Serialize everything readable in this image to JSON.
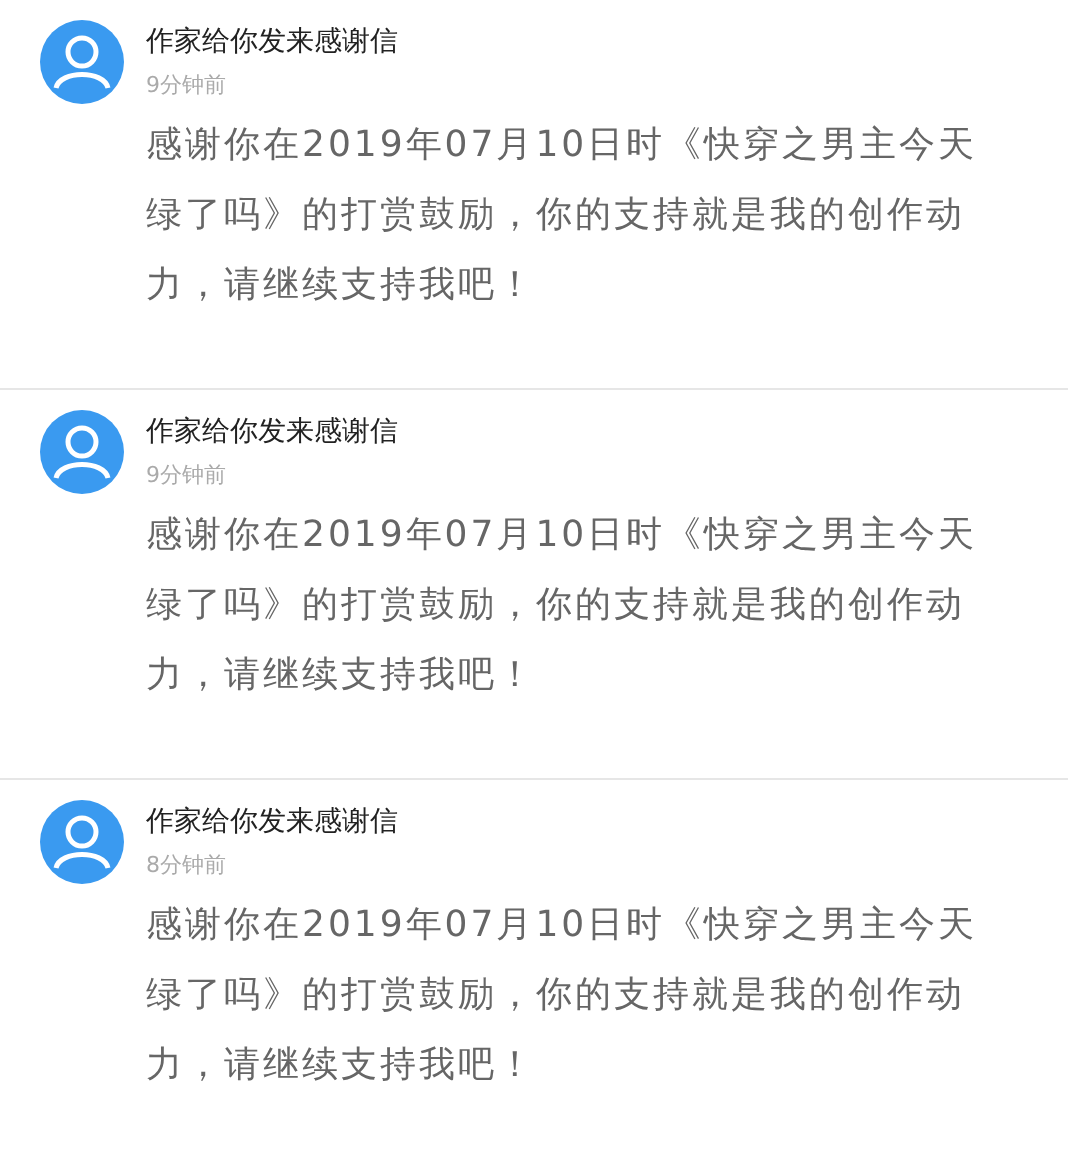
{
  "messages": [
    {
      "title": "作家给你发来感谢信",
      "time": "9分钟前",
      "body": "感谢你在2019年07月10日时《快穿之男主今天绿了吗》的打赏鼓励，你的支持就是我的创作动力，请继续支持我吧！"
    },
    {
      "title": "作家给你发来感谢信",
      "time": "9分钟前",
      "body": "感谢你在2019年07月10日时《快穿之男主今天绿了吗》的打赏鼓励，你的支持就是我的创作动力，请继续支持我吧！"
    },
    {
      "title": "作家给你发来感谢信",
      "time": "8分钟前",
      "body": "感谢你在2019年07月10日时《快穿之男主今天绿了吗》的打赏鼓励，你的支持就是我的创作动力，请继续支持我吧！"
    }
  ]
}
